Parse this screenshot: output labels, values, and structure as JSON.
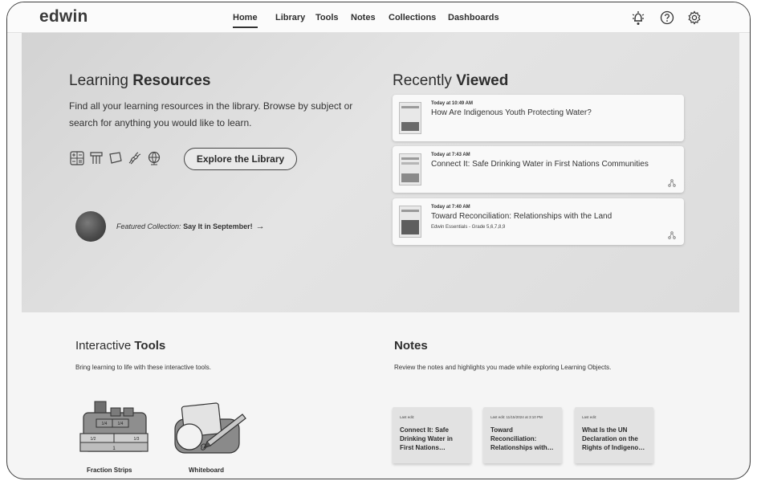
{
  "app": {
    "logo": "edwin"
  },
  "nav": {
    "items": [
      {
        "label": "Home",
        "active": true
      },
      {
        "label": "Library"
      },
      {
        "label": "Tools"
      },
      {
        "label": "Notes"
      },
      {
        "label": "Collections"
      },
      {
        "label": "Dashboards"
      }
    ]
  },
  "header_icons": [
    "notification-bell-icon",
    "help-icon",
    "settings-gear-icon"
  ],
  "learning_resources": {
    "title_plain": "Learning ",
    "title_bold": "Resources",
    "description": "Find all your learning resources in the library. Browse by subject or search for anything you would like to learn.",
    "subject_icons": [
      "math-icon",
      "art-icon",
      "book-icon",
      "science-icon",
      "globe-icon"
    ],
    "explore_button": "Explore the Library",
    "featured_label": "Featured Collection:",
    "featured_name": "Say It in September!",
    "featured_arrow": "→"
  },
  "recently_viewed": {
    "title_plain": "Recently ",
    "title_bold": "Viewed",
    "items": [
      {
        "time": "Today at 10:49 AM",
        "title": "How Are Indigenous Youth Protecting Water?",
        "meta": ""
      },
      {
        "time": "Today at 7:43 AM",
        "title": "Connect It: Safe Drinking Water in First Nations Communities",
        "meta": ""
      },
      {
        "time": "Today at 7:40 AM",
        "title": "Toward Reconciliation: Relationships with the Land",
        "meta": "Edwin Essentials - Grade 5,6,7,8,9"
      }
    ]
  },
  "interactive_tools": {
    "title_plain": "Interactive ",
    "title_bold": "Tools",
    "description": "Bring learning to life with these interactive tools.",
    "tools": [
      {
        "label": "Fraction Strips",
        "icon": "fraction-strips-icon"
      },
      {
        "label": "Whiteboard",
        "icon": "whiteboard-icon"
      }
    ],
    "fractions": {
      "one": "1",
      "half": "1/2",
      "quarter": "1/4",
      "third": "1/3"
    }
  },
  "notes": {
    "title": "Notes",
    "description": "Review the notes and highlights you made while exploring Learning Objects.",
    "cards": [
      {
        "last_edit": "Last edit:",
        "title": "Connect It: Safe Drinking Water in First Nations…"
      },
      {
        "last_edit": "Last edit: 11/15/2024 at 3:10 PM",
        "title": "Toward Reconciliation: Relationships with…"
      },
      {
        "last_edit": "Last edit:",
        "title": "What Is the UN Declaration on the Rights of Indigeno…"
      }
    ]
  },
  "colors": {
    "hero_bg": "#dcdcdc",
    "text": "#2e2e2e",
    "card_bg": "#f9f9f9",
    "note_bg": "#e2e2e2"
  }
}
